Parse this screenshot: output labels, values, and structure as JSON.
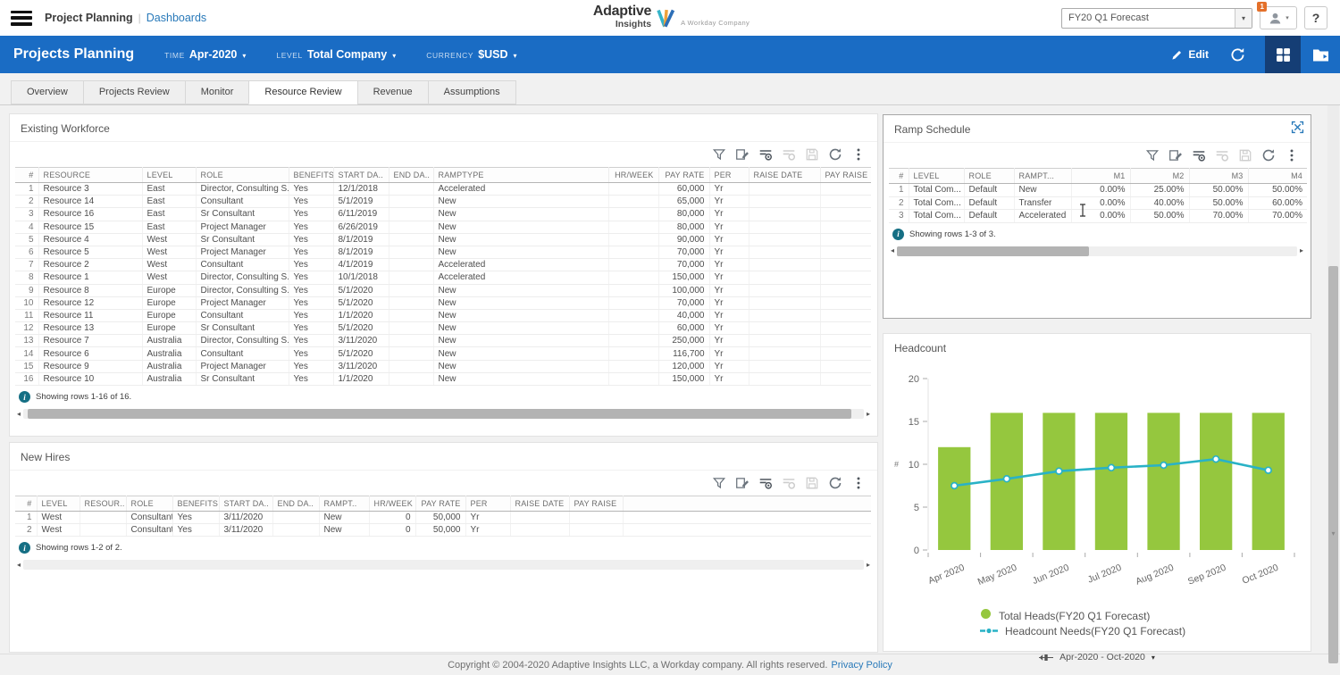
{
  "icons": {
    "hamburger": "hamburger-menu",
    "pipe": "|",
    "caret": "▾",
    "help": "?",
    "info": "i",
    "arrow_left": "◂",
    "arrow_right": "▸",
    "arrow_down": "▾",
    "kebab": "⋮"
  },
  "topbar": {
    "app_title": "Project Planning",
    "breadcrumb_link": "Dashboards",
    "forecast_select": "FY20 Q1 Forecast",
    "user_badge": "1",
    "logo": {
      "name_top": "Adaptive",
      "name_bottom": "Insights",
      "tagline": "A Workday Company"
    }
  },
  "header": {
    "title": "Projects Planning",
    "time_label": "TIME",
    "time_value": "Apr-2020",
    "level_label": "LEVEL",
    "level_value": "Total Company",
    "currency_label": "CURRENCY",
    "currency_value": "$USD",
    "edit_label": "Edit"
  },
  "tabs": [
    {
      "label": "Overview",
      "active": false
    },
    {
      "label": "Projects Review",
      "active": false
    },
    {
      "label": "Monitor",
      "active": false
    },
    {
      "label": "Resource Review",
      "active": true
    },
    {
      "label": "Revenue",
      "active": false
    },
    {
      "label": "Assumptions",
      "active": false
    }
  ],
  "existing_workforce": {
    "title": "Existing Workforce",
    "columns": [
      "#",
      "RESOURCE",
      "LEVEL",
      "ROLE",
      "BENEFITS",
      "START DA..",
      "END DA..",
      "RAMPTYPE",
      "HR/WEEK",
      "PAY RATE",
      "PER",
      "RAISE DATE",
      "PAY RAISE"
    ],
    "rows": [
      [
        "1",
        "Resource 3",
        "East",
        "Director, Consulting S..",
        "Yes",
        "12/1/2018",
        "",
        "Accelerated",
        "",
        "60,000",
        "Yr",
        "",
        ""
      ],
      [
        "2",
        "Resource 14",
        "East",
        "Consultant",
        "Yes",
        "5/1/2019",
        "",
        "New",
        "",
        "65,000",
        "Yr",
        "",
        ""
      ],
      [
        "3",
        "Resource 16",
        "East",
        "Sr Consultant",
        "Yes",
        "6/11/2019",
        "",
        "New",
        "",
        "80,000",
        "Yr",
        "",
        ""
      ],
      [
        "4",
        "Resource 15",
        "East",
        "Project Manager",
        "Yes",
        "6/26/2019",
        "",
        "New",
        "",
        "80,000",
        "Yr",
        "",
        ""
      ],
      [
        "5",
        "Resource 4",
        "West",
        "Sr Consultant",
        "Yes",
        "8/1/2019",
        "",
        "New",
        "",
        "90,000",
        "Yr",
        "",
        ""
      ],
      [
        "6",
        "Resource 5",
        "West",
        "Project Manager",
        "Yes",
        "8/1/2019",
        "",
        "New",
        "",
        "70,000",
        "Yr",
        "",
        ""
      ],
      [
        "7",
        "Resource 2",
        "West",
        "Consultant",
        "Yes",
        "4/1/2019",
        "",
        "Accelerated",
        "",
        "70,000",
        "Yr",
        "",
        ""
      ],
      [
        "8",
        "Resource 1",
        "West",
        "Director, Consulting S..",
        "Yes",
        "10/1/2018",
        "",
        "Accelerated",
        "",
        "150,000",
        "Yr",
        "",
        ""
      ],
      [
        "9",
        "Resource 8",
        "Europe",
        "Director, Consulting S..",
        "Yes",
        "5/1/2020",
        "",
        "New",
        "",
        "100,000",
        "Yr",
        "",
        ""
      ],
      [
        "10",
        "Resource 12",
        "Europe",
        "Project Manager",
        "Yes",
        "5/1/2020",
        "",
        "New",
        "",
        "70,000",
        "Yr",
        "",
        ""
      ],
      [
        "11",
        "Resource 11",
        "Europe",
        "Consultant",
        "Yes",
        "1/1/2020",
        "",
        "New",
        "",
        "40,000",
        "Yr",
        "",
        ""
      ],
      [
        "12",
        "Resource 13",
        "Europe",
        "Sr Consultant",
        "Yes",
        "5/1/2020",
        "",
        "New",
        "",
        "60,000",
        "Yr",
        "",
        ""
      ],
      [
        "13",
        "Resource 7",
        "Australia",
        "Director, Consulting S..",
        "Yes",
        "3/11/2020",
        "",
        "New",
        "",
        "250,000",
        "Yr",
        "",
        ""
      ],
      [
        "14",
        "Resource 6",
        "Australia",
        "Consultant",
        "Yes",
        "5/1/2020",
        "",
        "New",
        "",
        "116,700",
        "Yr",
        "",
        ""
      ],
      [
        "15",
        "Resource 9",
        "Australia",
        "Project Manager",
        "Yes",
        "3/11/2020",
        "",
        "New",
        "",
        "120,000",
        "Yr",
        "",
        ""
      ],
      [
        "16",
        "Resource 10",
        "Australia",
        "Sr Consultant",
        "Yes",
        "1/1/2020",
        "",
        "New",
        "",
        "150,000",
        "Yr",
        "",
        ""
      ]
    ],
    "status": "Showing rows 1-16 of 16."
  },
  "new_hires": {
    "title": "New Hires",
    "columns": [
      "#",
      "LEVEL",
      "RESOUR..",
      "ROLE",
      "BENEFITS",
      "START DA..",
      "END DA..",
      "RAMPT..",
      "HR/WEEK",
      "PAY RATE",
      "PER",
      "RAISE DATE",
      "PAY RAISE"
    ],
    "rows": [
      [
        "1",
        "West",
        "",
        "Consultant",
        "Yes",
        "3/11/2020",
        "",
        "New",
        "0",
        "50,000",
        "Yr",
        "",
        ""
      ],
      [
        "2",
        "West",
        "",
        "Consultant",
        "Yes",
        "3/11/2020",
        "",
        "New",
        "0",
        "50,000",
        "Yr",
        "",
        ""
      ]
    ],
    "status": "Showing rows 1-2 of 2."
  },
  "ramp_schedule": {
    "title": "Ramp Schedule",
    "columns": [
      "#",
      "LEVEL",
      "ROLE",
      "RAMPT...",
      "M1",
      "M2",
      "M3",
      "M4"
    ],
    "rows": [
      [
        "1",
        "Total Com...",
        "Default",
        "New",
        "0.00%",
        "25.00%",
        "50.00%",
        "50.00%"
      ],
      [
        "2",
        "Total Com...",
        "Default",
        "Transfer",
        "0.00%",
        "40.00%",
        "50.00%",
        "60.00%"
      ],
      [
        "3",
        "Total Com...",
        "Default",
        "Accelerated",
        "0.00%",
        "50.00%",
        "70.00%",
        "70.00%"
      ]
    ],
    "status": "Showing rows 1-3 of 3."
  },
  "chart_data": {
    "type": "bar",
    "title": "Headcount",
    "categories": [
      "Apr 2020",
      "May 2020",
      "Jun 2020",
      "Jul 2020",
      "Aug 2020",
      "Sep 2020",
      "Oct 2020"
    ],
    "series": [
      {
        "name": "Total Heads(FY20 Q1 Forecast)",
        "kind": "bar",
        "color": "#95c73e",
        "values": [
          12,
          16,
          16,
          16,
          16,
          16,
          16
        ]
      },
      {
        "name": "Headcount Needs(FY20 Q1 Forecast)",
        "kind": "line",
        "color": "#29b2c6",
        "values": [
          7.5,
          8.3,
          9.2,
          9.6,
          9.9,
          10.6,
          9.3
        ]
      }
    ],
    "xlabel": "",
    "ylabel": "#",
    "ylim": [
      0,
      20
    ],
    "yticks": [
      0,
      5,
      10,
      15,
      20
    ],
    "grid": false,
    "legend_position": "bottom",
    "x_range_label": "Apr-2020 - Oct-2020"
  },
  "footer": {
    "copyright": "Copyright © 2004-2020 Adaptive Insights LLC, a Workday company. All rights reserved.",
    "privacy_link": "Privacy Policy"
  }
}
